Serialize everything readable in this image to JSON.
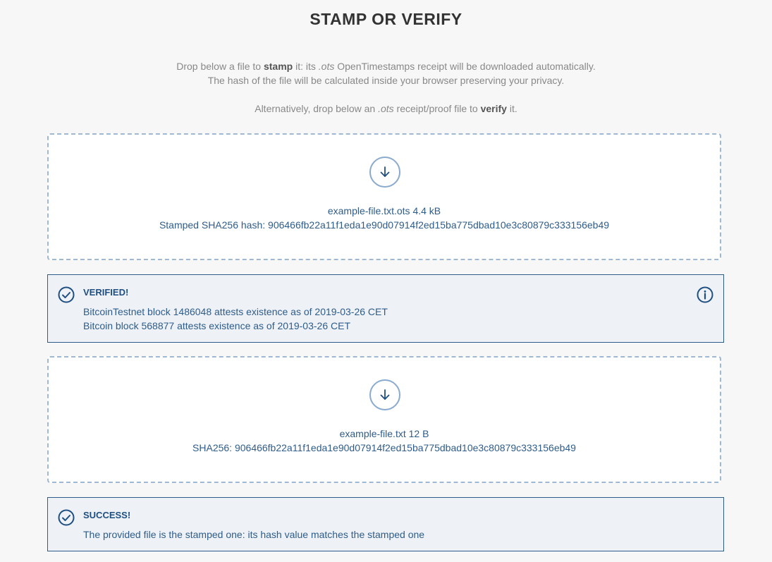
{
  "page": {
    "title": "STAMP OR VERIFY"
  },
  "intro": {
    "line1_a": "Drop below a file to ",
    "line1_b": "stamp",
    "line1_c": " it: its ",
    "line1_d": ".ots",
    "line1_e": " OpenTimestamps receipt will be downloaded automatically.",
    "line2": "The hash of the file will be calculated inside your browser preserving your privacy.",
    "line3_a": "Alternatively, drop below an ",
    "line3_b": ".ots",
    "line3_c": " receipt/proof file to ",
    "line3_d": "verify",
    "line3_e": " it."
  },
  "stamp_drop": {
    "icon": "arrow-down-circle-icon",
    "file_info": "example-file.txt.ots 4.4 kB",
    "hash_line": "Stamped SHA256 hash: 906466fb22a11f1eda1e90d07914f2ed15ba775dbad10e3c80879c333156eb49"
  },
  "verify_status": {
    "icon": "check-circle-icon",
    "title": "VERIFIED!",
    "lines": [
      "BitcoinTestnet block 1486048 attests existence as of 2019-03-26 CET",
      "Bitcoin block 568877 attests existence as of 2019-03-26 CET"
    ],
    "info_icon": "info-icon"
  },
  "file_drop": {
    "icon": "arrow-down-circle-icon",
    "file_info": "example-file.txt 12 B",
    "hash_line": "SHA256: 906466fb22a11f1eda1e90d07914f2ed15ba775dbad10e3c80879c333156eb49"
  },
  "success_status": {
    "icon": "check-circle-icon",
    "title": "SUCCESS!",
    "lines": [
      "The provided file is the stamped one: its hash value matches the stamped one"
    ]
  },
  "colors": {
    "accent": "#2e5c8a",
    "dashed_border": "#9fb8d4",
    "status_bg": "#eef2f7"
  }
}
